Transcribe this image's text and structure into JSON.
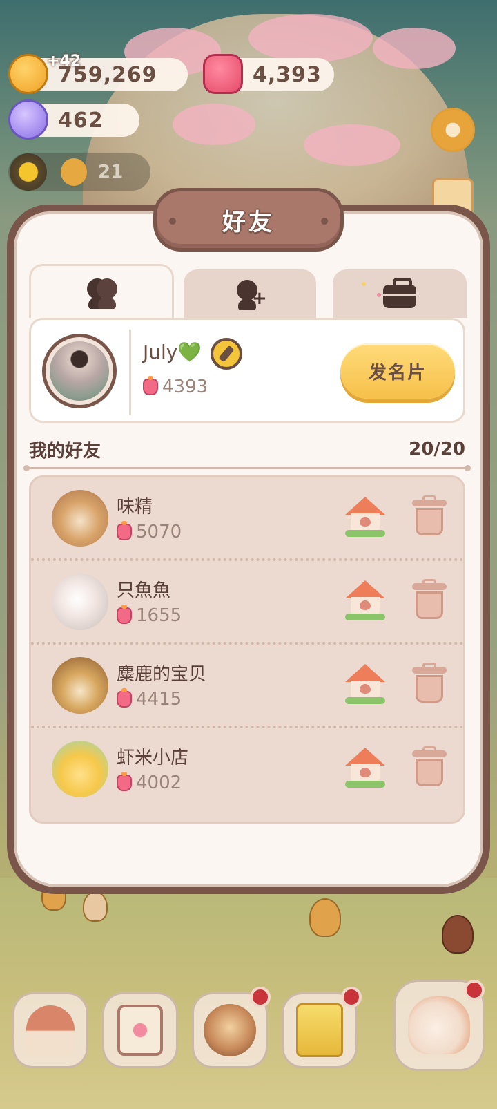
{
  "resources": {
    "coins": "759,269",
    "coins_gain": "+42",
    "rubies": "4,393",
    "gems": "462",
    "sun_count": "21"
  },
  "panel": {
    "title": "好友",
    "tabs": [
      {
        "id": "friends",
        "icon": "friends-icon",
        "active": true
      },
      {
        "id": "add-friend",
        "icon": "add-friend-icon",
        "active": false
      },
      {
        "id": "bag",
        "icon": "briefcase-icon",
        "active": false
      }
    ],
    "profile": {
      "name": "July💚",
      "score": "4393",
      "card_button_label": "发名片"
    },
    "friends_header": {
      "title": "我的好友",
      "count": "20/20"
    },
    "friends": [
      {
        "name": "味精",
        "score": "5070",
        "avatar_color": "#d9a46a"
      },
      {
        "name": "只魚魚",
        "score": "1655",
        "avatar_color": "#f2e6e2"
      },
      {
        "name": "麋鹿的宝贝",
        "score": "4415",
        "avatar_color": "#b8844a"
      },
      {
        "name": "虾米小店",
        "score": "4002",
        "avatar_color": "#f6d36a"
      }
    ]
  },
  "toolbar": {
    "buttons": [
      {
        "icon": "mushroom-house-icon",
        "badge": false
      },
      {
        "icon": "notebook-heart-icon",
        "badge": false
      },
      {
        "icon": "cookie-character-icon",
        "badge": true
      },
      {
        "icon": "shop-bag-icon",
        "badge": true
      },
      {
        "icon": "character-clock-icon",
        "badge": true
      }
    ]
  },
  "colors": {
    "panel_border": "#7a564a",
    "accent_yellow": "#f6c04a",
    "text_brown": "#6b4f43",
    "list_bg": "#ecd9d0"
  }
}
